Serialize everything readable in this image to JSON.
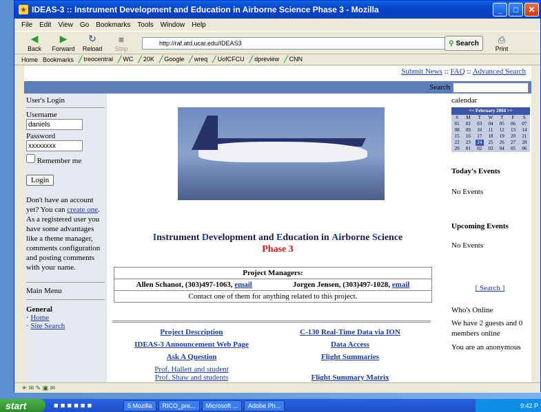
{
  "window": {
    "title": "IDEAS-3 :: Instrument Development and Education in Airborne Science Phase 3 - Mozilla"
  },
  "menu": [
    "File",
    "Edit",
    "View",
    "Go",
    "Bookmarks",
    "Tools",
    "Window",
    "Help"
  ],
  "nav": {
    "back": "Back",
    "forward": "Forward",
    "reload": "Reload",
    "stop": "Stop",
    "url": "http://raf.atd.ucar.edu/IDEAS3",
    "search": "Search",
    "print": "Print"
  },
  "bookmarks": [
    "Home",
    "Bookmarks",
    "treocentral",
    "WC",
    "20K",
    "Google",
    "wreq",
    "UofCFCU",
    "dpreview",
    "CNN"
  ],
  "page": {
    "top_links": [
      "Submit News",
      "FAQ",
      "Advanced Search"
    ],
    "search_label": "Search",
    "login": {
      "title": "User's Login",
      "username_label": "Username",
      "username_value": "daniels",
      "password_label": "Password",
      "password_value": "xxxxxxxx",
      "remember": "Remember me",
      "button": "Login",
      "note_prefix": "Don't have an account yet? You can ",
      "note_link": "create one",
      "note_suffix": ". As a registered user you have some advantages like a theme manager, comments configuration and posting comments with your name."
    },
    "main_menu": "Main Menu",
    "general": "General",
    "menu_items": [
      "Home",
      "Site Search"
    ],
    "heading1": [
      "I",
      "nstrument ",
      "D",
      "evelopment and ",
      "E",
      "ducation in ",
      "A",
      "irborne ",
      "S",
      "cience"
    ],
    "heading2": "Phase 3",
    "pm_title": "Project Managers:",
    "pm1": "Allen Schanot, (303)497-1063, ",
    "pm2": "Jorgen Jensen, (303)497-1028, ",
    "email": "email",
    "pm_note": "Contact one of them for anything related to this project.",
    "links_left": [
      "Project Description",
      "IDEAS-3 Announcement Web Page",
      "Ask A Question",
      "Prof. Hallett and student",
      "Prof. Shaw and students"
    ],
    "links_right": [
      "C-130 Real-Time Data via ION",
      "Data Access",
      "Flight Summaries",
      "",
      "Flight Summary Matrix"
    ],
    "right": {
      "calendar": "calendar",
      "cal_header": "<< February 2004 >>",
      "days": [
        "S",
        "M",
        "T",
        "W",
        "T",
        "F",
        "S"
      ],
      "weeks": [
        [
          "01",
          "02",
          "03",
          "04",
          "05",
          "06",
          "07"
        ],
        [
          "08",
          "09",
          "10",
          "11",
          "12",
          "13",
          "14"
        ],
        [
          "15",
          "16",
          "17",
          "18",
          "19",
          "20",
          "21"
        ],
        [
          "22",
          "23",
          "24",
          "25",
          "26",
          "27",
          "28"
        ],
        [
          "29",
          "01",
          "02",
          "03",
          "04",
          "05",
          "06"
        ]
      ],
      "today": "Today's Events",
      "no_events": "No Events",
      "upcoming": "Upcoming Events",
      "search_link": "[ Search ]",
      "whos_online": "Who's Online",
      "online_text": "We have 2 guests and 0 members online",
      "anon": "You are an anonymous"
    }
  },
  "taskbar": {
    "start": "start",
    "tasks": [
      "5 Mozilla",
      "RICO_pre...",
      "Microsoft ...",
      "Adobe Ph..."
    ],
    "time": "9:42 P"
  }
}
